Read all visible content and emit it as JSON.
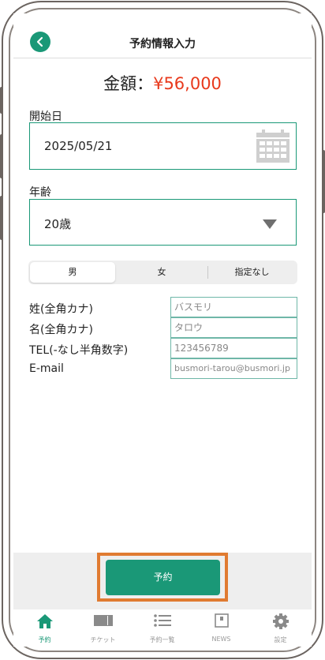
{
  "header": {
    "title": "予約情報入力"
  },
  "amount": {
    "label": "金額：",
    "value": "¥56,000"
  },
  "start_date": {
    "label": "開始日",
    "value": "2025/05/21"
  },
  "age": {
    "label": "年齢",
    "value": "20歳"
  },
  "gender": {
    "options": [
      "男",
      "女",
      "指定なし"
    ],
    "selected": "男"
  },
  "form": {
    "rows": [
      {
        "label": "姓(全角カナ)",
        "value": "バスモリ"
      },
      {
        "label": "名(全角カナ)",
        "value": "タロウ"
      },
      {
        "label": "TEL(-なし半角数字)",
        "value": "123456789"
      },
      {
        "label": "E-mail",
        "value": "busmori-tarou@busmori.jp"
      }
    ]
  },
  "action": {
    "reserve_label": "予約"
  },
  "tabbar": {
    "items": [
      {
        "label": "予約",
        "icon": "home-icon",
        "active": true
      },
      {
        "label": "チケット",
        "icon": "ticket-icon",
        "active": false
      },
      {
        "label": "予約一覧",
        "icon": "list-icon",
        "active": false
      },
      {
        "label": "NEWS",
        "icon": "news-icon",
        "active": false
      },
      {
        "label": "設定",
        "icon": "gear-icon",
        "active": false
      }
    ]
  },
  "colors": {
    "accent": "#1a9877",
    "price": "#e8391c",
    "highlight": "#e07b31"
  }
}
